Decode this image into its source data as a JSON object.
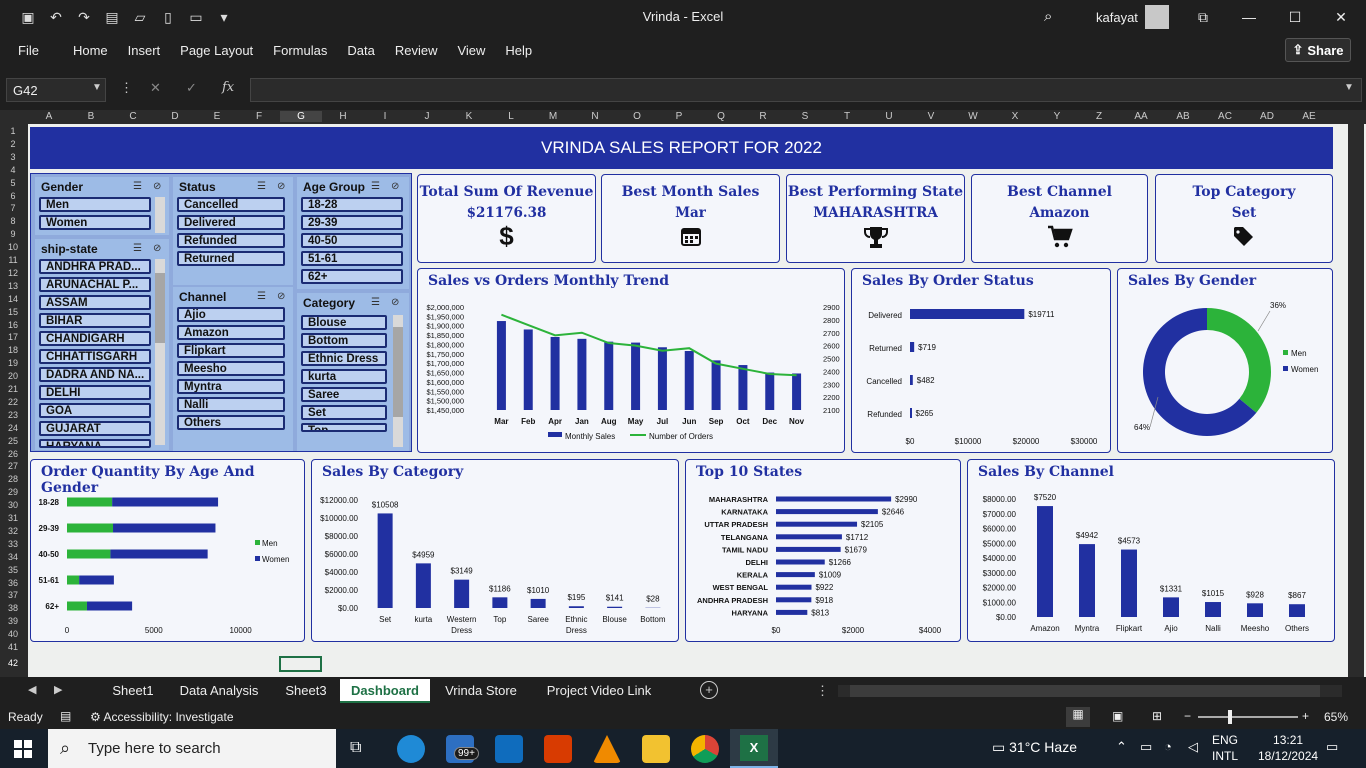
{
  "window": {
    "title": "Vrinda  -  Excel",
    "user": "kafayat"
  },
  "menu": [
    "File",
    "Home",
    "Insert",
    "Page Layout",
    "Formulas",
    "Data",
    "Review",
    "View",
    "Help"
  ],
  "share_label": "Share",
  "namebox": "G42",
  "fx_label": "fx",
  "columns": [
    "A",
    "B",
    "C",
    "D",
    "E",
    "F",
    "G",
    "H",
    "I",
    "J",
    "K",
    "L",
    "M",
    "N",
    "O",
    "P",
    "Q",
    "R",
    "S",
    "T",
    "U",
    "V",
    "W",
    "X",
    "Y",
    "Z",
    "AA",
    "AB",
    "AC",
    "AD",
    "AE"
  ],
  "rows": [
    "1",
    "2",
    "3",
    "4",
    "5",
    "6",
    "7",
    "8",
    "9",
    "10",
    "11",
    "12",
    "13",
    "14",
    "15",
    "16",
    "17",
    "18",
    "19",
    "20",
    "21",
    "22",
    "23",
    "24",
    "25",
    "26",
    "27",
    "28",
    "29",
    "30",
    "31",
    "32",
    "33",
    "34",
    "35",
    "36",
    "37",
    "38",
    "39",
    "40",
    "41",
    "42"
  ],
  "dashboard": {
    "banner": "VRINDA SALES REPORT FOR 2022",
    "kpis": [
      {
        "title": "Total Sum Of Revenue",
        "value": "$21176.38",
        "icon": "dollar-icon"
      },
      {
        "title": "Best Month Sales",
        "value": "Mar",
        "icon": "calendar-icon"
      },
      {
        "title": "Best Performing State",
        "value": "MAHARASHTRA",
        "icon": "trophy-icon"
      },
      {
        "title": "Best Channel",
        "value": "Amazon",
        "icon": "cart-icon"
      },
      {
        "title": "Top Category",
        "value": "Set",
        "icon": "tag-icon"
      }
    ],
    "slicers": {
      "gender": {
        "title": "Gender",
        "items": [
          "Men",
          "Women"
        ]
      },
      "ship_state": {
        "title": "ship-state",
        "items": [
          "ANDHRA PRAD...",
          "ARUNACHAL P...",
          "ASSAM",
          "BIHAR",
          "CHANDIGARH",
          "CHHATTISGARH",
          "DADRA AND NA...",
          "DELHI",
          "GOA",
          "GUJARAT",
          "HARYANA"
        ]
      },
      "status": {
        "title": "Status",
        "items": [
          "Cancelled",
          "Delivered",
          "Refunded",
          "Returned"
        ]
      },
      "channel": {
        "title": "Channel",
        "items": [
          "Ajio",
          "Amazon",
          "Flipkart",
          "Meesho",
          "Myntra",
          "Nalli",
          "Others"
        ]
      },
      "age_group": {
        "title": "Age Group",
        "items": [
          "18-28",
          "29-39",
          "40-50",
          "51-61",
          "62+"
        ]
      },
      "category": {
        "title": "Category",
        "items": [
          "Blouse",
          "Bottom",
          "Ethnic Dress",
          "kurta",
          "Saree",
          "Set",
          "Top",
          "Western Dress"
        ]
      }
    }
  },
  "chart_data": [
    {
      "type": "bar",
      "title": "Sales vs Orders Monthly Trend",
      "categories": [
        "Mar",
        "Feb",
        "Apr",
        "Jan",
        "Aug",
        "May",
        "Jul",
        "Jun",
        "Sep",
        "Oct",
        "Dec",
        "Nov"
      ],
      "series": [
        {
          "name": "Monthly Sales",
          "values": [
            1925000,
            1880000,
            1840000,
            1830000,
            1815000,
            1810000,
            1785000,
            1765000,
            1715000,
            1690000,
            1650000,
            1645000
          ]
        },
        {
          "name": "Number of Orders",
          "type": "line",
          "values": [
            2840,
            2760,
            2680,
            2700,
            2620,
            2600,
            2560,
            2580,
            2460,
            2420,
            2380,
            2370
          ]
        }
      ],
      "y_ticks": [
        "$2,000,000",
        "$1,950,000",
        "$1,900,000",
        "$1,850,000",
        "$1,800,000",
        "$1,750,000",
        "$1,700,000",
        "$1,650,000",
        "$1,600,000",
        "$1,550,000",
        "$1,500,000",
        "$1,450,000"
      ],
      "y2_ticks": [
        "2900",
        "2800",
        "2700",
        "2600",
        "2500",
        "2400",
        "2300",
        "2200",
        "2100"
      ],
      "ylim": [
        1450000,
        2000000
      ],
      "y2lim": [
        2100,
        2900
      ]
    },
    {
      "type": "bar",
      "title": "Sales By Order Status",
      "categories": [
        "Delivered",
        "Returned",
        "Cancelled",
        "Refunded"
      ],
      "values": [
        19711,
        719,
        482,
        265
      ],
      "labels": [
        "$19711",
        "$719",
        "$482",
        "$265"
      ],
      "x_ticks": [
        "$0",
        "$10000",
        "$20000",
        "$30000"
      ],
      "xlim": [
        0,
        30000
      ]
    },
    {
      "type": "pie",
      "title": "Sales By Gender",
      "categories": [
        "Men",
        "Women"
      ],
      "values": [
        36,
        64
      ],
      "labels": [
        "36%",
        "64%"
      ]
    },
    {
      "type": "bar",
      "title": "Order Quantity By Age And Gender",
      "categories": [
        "18-28",
        "29-39",
        "40-50",
        "51-61",
        "62+"
      ],
      "series": [
        {
          "name": "Men",
          "values": [
            2600,
            2650,
            2500,
            700,
            1150
          ]
        },
        {
          "name": "Women",
          "values": [
            6100,
            5900,
            5600,
            2000,
            2600
          ]
        }
      ],
      "x_ticks": [
        "0",
        "5000",
        "10000"
      ],
      "xlim": [
        0,
        11000
      ]
    },
    {
      "type": "bar",
      "title": "Sales By Category",
      "categories": [
        "Set",
        "kurta",
        "Western Dress",
        "Top",
        "Saree",
        "Ethnic Dress",
        "Blouse",
        "Bottom"
      ],
      "values": [
        10508,
        4959,
        3149,
        1186,
        1010,
        195,
        141,
        28
      ],
      "labels": [
        "$10508",
        "$4959",
        "$3149",
        "$1186",
        "$1010",
        "$195",
        "$141",
        "$28"
      ],
      "y_ticks": [
        "$12000.00",
        "$10000.00",
        "$8000.00",
        "$6000.00",
        "$4000.00",
        "$2000.00",
        "$0.00"
      ],
      "ylim": [
        0,
        12000
      ]
    },
    {
      "type": "bar",
      "title": "Top 10 States",
      "categories": [
        "MAHARASHTRA",
        "KARNATAKA",
        "UTTAR PRADESH",
        "TELANGANA",
        "TAMIL NADU",
        "DELHI",
        "KERALA",
        "WEST BENGAL",
        "ANDHRA PRADESH",
        "HARYANA"
      ],
      "values": [
        2990,
        2646,
        2105,
        1712,
        1679,
        1266,
        1009,
        922,
        918,
        813
      ],
      "labels": [
        "$2990",
        "$2646",
        "$2105",
        "$1712",
        "$1679",
        "$1266",
        "$1009",
        "$922",
        "$918",
        "$813"
      ],
      "x_ticks": [
        "$0",
        "$2000",
        "$4000"
      ],
      "xlim": [
        0,
        4000
      ]
    },
    {
      "type": "bar",
      "title": "Sales By Channel",
      "categories": [
        "Amazon",
        "Myntra",
        "Flipkart",
        "Ajio",
        "Nalli",
        "Meesho",
        "Others"
      ],
      "values": [
        7520,
        4942,
        4573,
        1331,
        1015,
        928,
        867
      ],
      "labels": [
        "$7520",
        "$4942",
        "$4573",
        "$1331",
        "$1015",
        "$928",
        "$867"
      ],
      "y_ticks": [
        "$8000.00",
        "$7000.00",
        "$6000.00",
        "$5000.00",
        "$4000.00",
        "$3000.00",
        "$2000.00",
        "$1000.00",
        "$0.00"
      ],
      "ylim": [
        0,
        8000
      ]
    }
  ],
  "tabs": [
    "Sheet1",
    "Data Analysis",
    "Sheet3",
    "Dashboard",
    "Vrinda Store",
    "Project Video Link"
  ],
  "status": {
    "ready": "Ready",
    "accessibility": "Accessibility: Investigate",
    "zoom": "65%"
  },
  "taskbar": {
    "search_placeholder": "Type here to search",
    "weather": "31°C  Haze",
    "lang1": "ENG",
    "lang2": "INTL",
    "time": "13:21",
    "date": "18/12/2024",
    "badge": "99+"
  },
  "colors": {
    "navy": "#2130a1",
    "green": "#2cb33a",
    "excel_green": "#1e7145"
  }
}
